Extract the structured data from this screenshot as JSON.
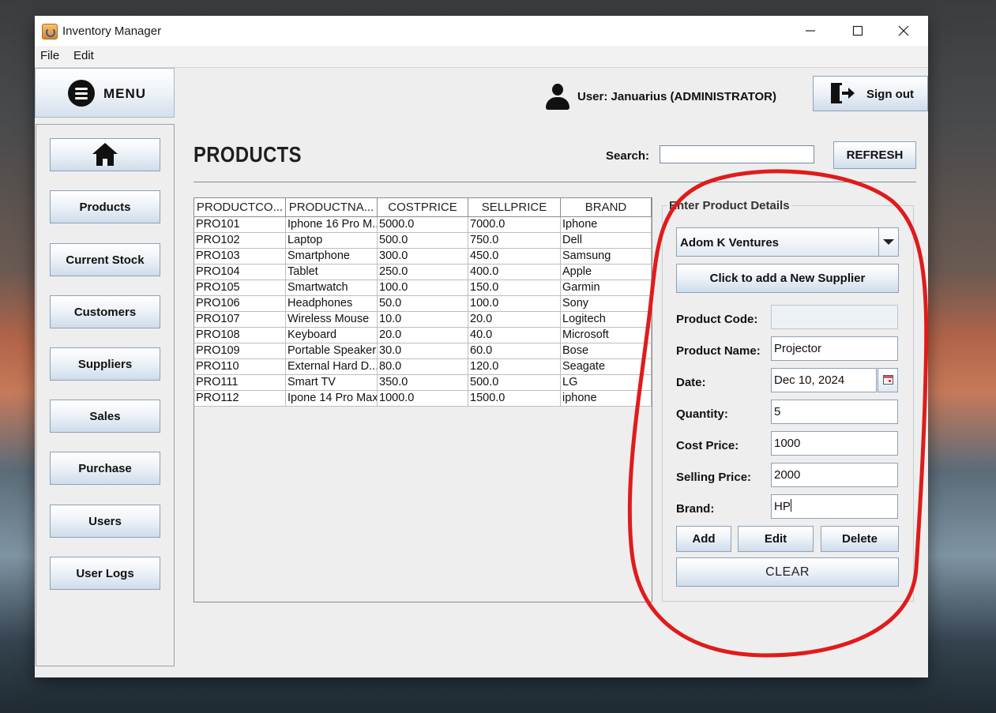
{
  "window": {
    "title": "Inventory Manager",
    "controls": [
      "minimize",
      "maximize",
      "close"
    ]
  },
  "menubar": {
    "file": "File",
    "edit": "Edit"
  },
  "sidebar": {
    "menu_label": "MENU",
    "items": [
      {
        "label": "",
        "icon": "home-icon"
      },
      {
        "label": "Products"
      },
      {
        "label": "Current Stock"
      },
      {
        "label": "Customers"
      },
      {
        "label": "Suppliers"
      },
      {
        "label": "Sales"
      },
      {
        "label": "Purchase"
      },
      {
        "label": "Users"
      },
      {
        "label": "User Logs"
      }
    ]
  },
  "header": {
    "user_text": "User: Januarius (ADMINISTRATOR)",
    "signout_label": "Sign out"
  },
  "page": {
    "title": "PRODUCTS",
    "search_label": "Search:",
    "search_value": "",
    "refresh_label": "REFRESH"
  },
  "table": {
    "columns": [
      "PRODUCTCO...",
      "PRODUCTNA...",
      "COSTPRICE",
      "SELLPRICE",
      "BRAND"
    ],
    "rows": [
      [
        "PRO101",
        "Iphone 16 Pro M...",
        "5000.0",
        "7000.0",
        "Iphone"
      ],
      [
        "PRO102",
        "Laptop",
        "500.0",
        "750.0",
        "Dell"
      ],
      [
        "PRO103",
        "Smartphone",
        "300.0",
        "450.0",
        "Samsung"
      ],
      [
        "PRO104",
        "Tablet",
        "250.0",
        "400.0",
        "Apple"
      ],
      [
        "PRO105",
        "Smartwatch",
        "100.0",
        "150.0",
        "Garmin"
      ],
      [
        "PRO106",
        "Headphones",
        "50.0",
        "100.0",
        "Sony"
      ],
      [
        "PRO107",
        "Wireless Mouse",
        "10.0",
        "20.0",
        "Logitech"
      ],
      [
        "PRO108",
        "Keyboard",
        "20.0",
        "40.0",
        "Microsoft"
      ],
      [
        "PRO109",
        "Portable Speaker",
        "30.0",
        "60.0",
        "Bose"
      ],
      [
        "PRO110",
        "External Hard D...",
        "80.0",
        "120.0",
        "Seagate"
      ],
      [
        "PRO111",
        "Smart TV",
        "350.0",
        "500.0",
        "LG"
      ],
      [
        "PRO112",
        "Ipone 14 Pro Max",
        "1000.0",
        "1500.0",
        "iphone"
      ]
    ]
  },
  "form": {
    "title": "Enter Product Details",
    "supplier_selected": "Adom K Ventures",
    "new_supplier_label": "Click to add a New Supplier",
    "product_code_label": "Product Code:",
    "product_code_value": "",
    "product_name_label": "Product Name:",
    "product_name_value": "Projector",
    "date_label": "Date:",
    "date_value": "Dec 10, 2024",
    "quantity_label": "Quantity:",
    "quantity_value": "5",
    "cost_price_label": "Cost Price:",
    "cost_price_value": "1000",
    "selling_price_label": "Selling Price:",
    "selling_price_value": "2000",
    "brand_label": "Brand:",
    "brand_value": "HP",
    "add_label": "Add",
    "edit_label": "Edit",
    "delete_label": "Delete",
    "clear_label": "CLEAR"
  },
  "colors": {
    "annotation": "#e01b1b",
    "button_gradient_end": "#cfdceb",
    "window_bg": "#eeeeee"
  }
}
